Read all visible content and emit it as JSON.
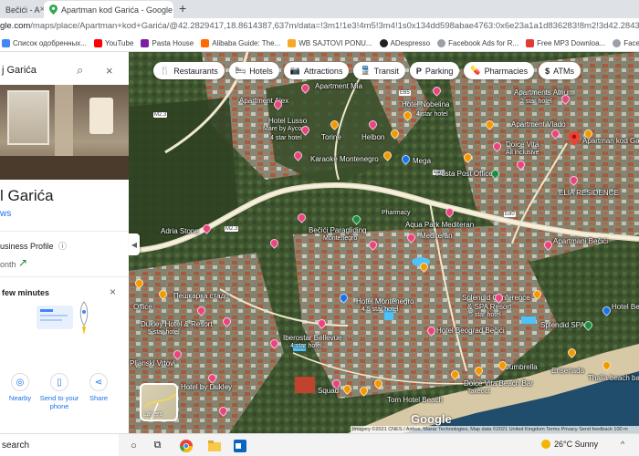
{
  "browser": {
    "tabs": [
      {
        "title": "Bečići - A",
        "active": false
      },
      {
        "title": "Apartman kod Garića - Google M",
        "active": true
      }
    ],
    "new_tab_symbol": "+",
    "url_host": "google.com",
    "url_rest": "/maps/place/Apartman+kod+Garića/@42.2829417,18.8614387,637m/data=!3m1!1e3!4m5!3m4!1s0x134dd598abae4763:0x6e23a1a1d836283!8m2!3d42.2843903!4d18.8666368?hl=en",
    "url_prefix": "gle.com"
  },
  "bookmarks": [
    {
      "label": "Список одобренных...",
      "color": "#4285f4"
    },
    {
      "label": "YouTube",
      "color": "#ff0000"
    },
    {
      "label": "Pasta House",
      "color": "#7b1fa2"
    },
    {
      "label": "Alibaba Guide: The...",
      "color": "#ff6a00"
    },
    {
      "label": "WB SAJTOVI PONU...",
      "color": "#f9a825"
    },
    {
      "label": "ADespresso",
      "color": "#222222"
    },
    {
      "label": "Facebook Ads for R...",
      "color": "#3c4043"
    },
    {
      "label": "Free MP3 Downloa...",
      "color": "#e53935"
    },
    {
      "label": "Facebook Ad Biddi...",
      "color": "#3c4043"
    }
  ],
  "panel": {
    "search_query": "j Garića",
    "title": "l Garića",
    "reviews_text": "ws",
    "business_profile": "usiness Profile",
    "month_text": "onth",
    "few_minutes": "few minutes",
    "actions": [
      {
        "label": "Nearby",
        "icon": "nearby-icon"
      },
      {
        "label": "Send to your phone",
        "icon": "send-to-phone-icon"
      },
      {
        "label": "Share",
        "icon": "share-icon"
      }
    ]
  },
  "chips": [
    {
      "label": "Restaurants",
      "icon": "restaurant-icon",
      "glyph": "🍴"
    },
    {
      "label": "Hotels",
      "icon": "hotel-icon",
      "glyph": "🛏"
    },
    {
      "label": "Attractions",
      "icon": "attractions-icon",
      "glyph": "📷"
    },
    {
      "label": "Transit",
      "icon": "transit-icon",
      "glyph": "🚆"
    },
    {
      "label": "Parking",
      "icon": "parking-icon",
      "glyph": "P"
    },
    {
      "label": "Pharmacies",
      "icon": "pharmacy-icon",
      "glyph": "💊"
    },
    {
      "label": "ATMs",
      "icon": "atm-icon",
      "glyph": "$"
    }
  ],
  "map_labels": {
    "apartment_mia": "Apartment Mia",
    "apartment_alex": "Apartment Alex",
    "apartments_atrium": "Apartments Atrium",
    "pearl_beach": "2 star hotel",
    "hotel_nobelina": "Hotel Nobelina",
    "hotel_stars": "4 star hotel",
    "apartment_vlado": "Apartment Vlado",
    "apartman_kod_garica": "Apartman kod Garića",
    "hotel_lusso": "Hotel Lusso",
    "hotel_lusso_sub": "Mare by Aycon",
    "hotel_lusso_stars": "4 star hotel",
    "torine": "Torine",
    "helbon": "Helbon",
    "karaoke": "Karaoke Montenegro",
    "mega": "Mega",
    "dolce_vita": "Dolce Vita",
    "dolce_vita_sub": "All inclusive",
    "posta": "Posta Post Office",
    "elia": "ELIA RESIDENCE",
    "adria_stone": "Adria Stone",
    "becici_paragliding": "Bečići Paragliding",
    "becici_paragliding_sub": "Montenegro",
    "pharmacy": "Pharmacy",
    "aqua_park": "Aqua Park Mediteran",
    "mediteran": "Mediteran",
    "apartmani_becici": "Apartmani Bečići",
    "apartment_becici": "Apartment Bečići",
    "piscarica": "Пешкарка стадо",
    "splendid": "Splendid Conference",
    "splendid2": "& SPA Resort",
    "splendid_stars": "5 star hotel",
    "splendid_spa": "Splendid SPA",
    "hotel_montenegro": "Hotel Montenegro",
    "hotel_montenegro_stars": "4.5 star hotel",
    "hotel_becici": "Hotel Bečići",
    "office": "Office",
    "dukley": "Dukley Hotel & Resort",
    "dukley_stars": "5 star hotel",
    "iberostar": "Iberostar Bellevue",
    "iberostar_sub": "4 star hotel",
    "hotel_beograd": "Hotel Beograd Bečići",
    "pljanski": "Pljanski Vrtovi",
    "hotel_dukley": "Hotel by Dukley",
    "dolce_vita_beach": "Dolce Vita Beach Bar",
    "dolce_vita_beach_sub": "Takeout",
    "cocktail_bar": "Ensenada",
    "jumbrella": "Jumbrella",
    "thalia_beach": "Thalia beach bar",
    "tonic": "Tonic",
    "squad": "Squad",
    "tom_hotel": "Tom Hotel Beach",
    "road_m23a": "M2.3",
    "road_m23b": "M2.3",
    "road_e80": "E80",
    "road_e80b": "E80",
    "road_e65": "E65",
    "sveti_stefan_st": "Mediteranska"
  },
  "layers_label": "Layers",
  "google_logo": "Google",
  "attribution": "Imagery ©2021 CNES / Airbus, Maxar Technologies, Map data ©2021   United Kingdom   Terms   Privacy   Send feedback   100 m",
  "taskbar": {
    "search_text": "search",
    "weather": "26°C  Sunny"
  }
}
